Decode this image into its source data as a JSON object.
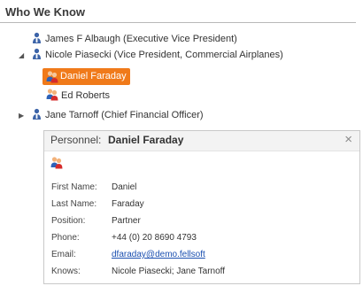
{
  "panel": {
    "title": "Who We Know"
  },
  "tree": {
    "items": [
      {
        "label": "James F Albaugh (Executive Vice President)"
      },
      {
        "label": "Nicole Piasecki (Vice President, Commercial Airplanes)",
        "expanded": true
      },
      {
        "label": "Daniel Faraday",
        "selected": true
      },
      {
        "label": "Ed Roberts"
      },
      {
        "label": "Jane Tarnoff (Chief Financial Officer)",
        "expanded": false
      }
    ]
  },
  "tooltip": {
    "prefix": "Personnel:",
    "name": "Daniel Faraday",
    "close_glyph": "×",
    "fields": [
      {
        "label": "First Name:",
        "value": "Daniel"
      },
      {
        "label": "Last Name:",
        "value": "Faraday"
      },
      {
        "label": "Position:",
        "value": "Partner"
      },
      {
        "label": "Phone:",
        "value": "+44 (0) 20 8690 4793"
      },
      {
        "label": "Email:",
        "value": "dfaraday@demo.fellsoft"
      },
      {
        "label": "Knows:",
        "value": "Nicole Piasecki; Jane Tarnoff"
      }
    ]
  },
  "icons": {
    "expanded_arrow": "expanded-triangle-icon",
    "collapsed_arrow": "collapsed-triangle-icon",
    "person": "person-icon",
    "group": "people-group-icon",
    "close": "close-icon"
  },
  "colors": {
    "selected_bg": "#f07a1a",
    "link": "#1a4fb0",
    "icon_blue": "#3b63a8"
  }
}
